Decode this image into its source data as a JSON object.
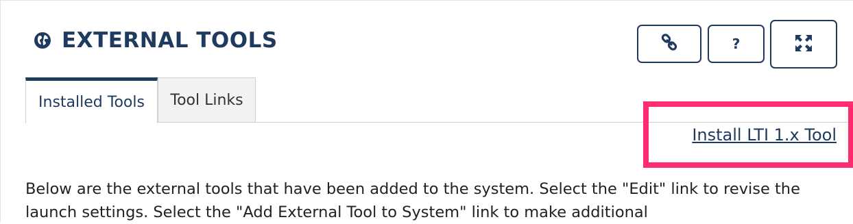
{
  "header": {
    "title": "EXTERNAL TOOLS",
    "title_icon": "globe-icon",
    "buttons": [
      {
        "name": "link-button",
        "icon": "link-icon"
      },
      {
        "name": "help-button",
        "icon": "help-icon",
        "glyph": "?"
      },
      {
        "name": "expand-button",
        "icon": "expand-icon"
      }
    ]
  },
  "tabs": [
    {
      "label": "Installed Tools",
      "active": true
    },
    {
      "label": "Tool Links",
      "active": false
    }
  ],
  "actions": {
    "install_link": "Install LTI 1.x Tool"
  },
  "content": {
    "description": "Below are the external tools that have been added to the system. Select the \"Edit\" link to revise the launch settings. Select the \"Add External Tool to System\" link to make additional"
  },
  "colors": {
    "primary": "#1e3a5f",
    "highlight": "#ff2d6f",
    "tab_inactive_bg": "#f2f2f2"
  }
}
